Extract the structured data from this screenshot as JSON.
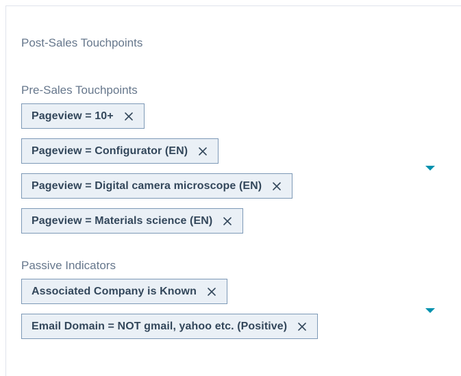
{
  "post_sales": {
    "label": "Post-Sales Touchpoints"
  },
  "pre_sales": {
    "label": "Pre-Sales Touchpoints",
    "chips": [
      {
        "label": "Pageview = 10+"
      },
      {
        "label": "Pageview = Configurator (EN)"
      },
      {
        "label": "Pageview = Digital camera microscope (EN)"
      },
      {
        "label": "Pageview = Materials science (EN)"
      }
    ]
  },
  "passive": {
    "label": "Passive Indicators",
    "chips": [
      {
        "label": "Associated Company is Known"
      },
      {
        "label": "Email Domain = NOT gmail, yahoo etc. (Positive)"
      }
    ]
  },
  "icons": {
    "chip_remove": "close-icon",
    "dropdown": "caret-down-icon"
  },
  "colors": {
    "chip_background": "#eaf0f6",
    "chip_border": "#7c98b6",
    "chip_text": "#33475b",
    "label_text": "#66778c",
    "caret": "#0091ae"
  }
}
